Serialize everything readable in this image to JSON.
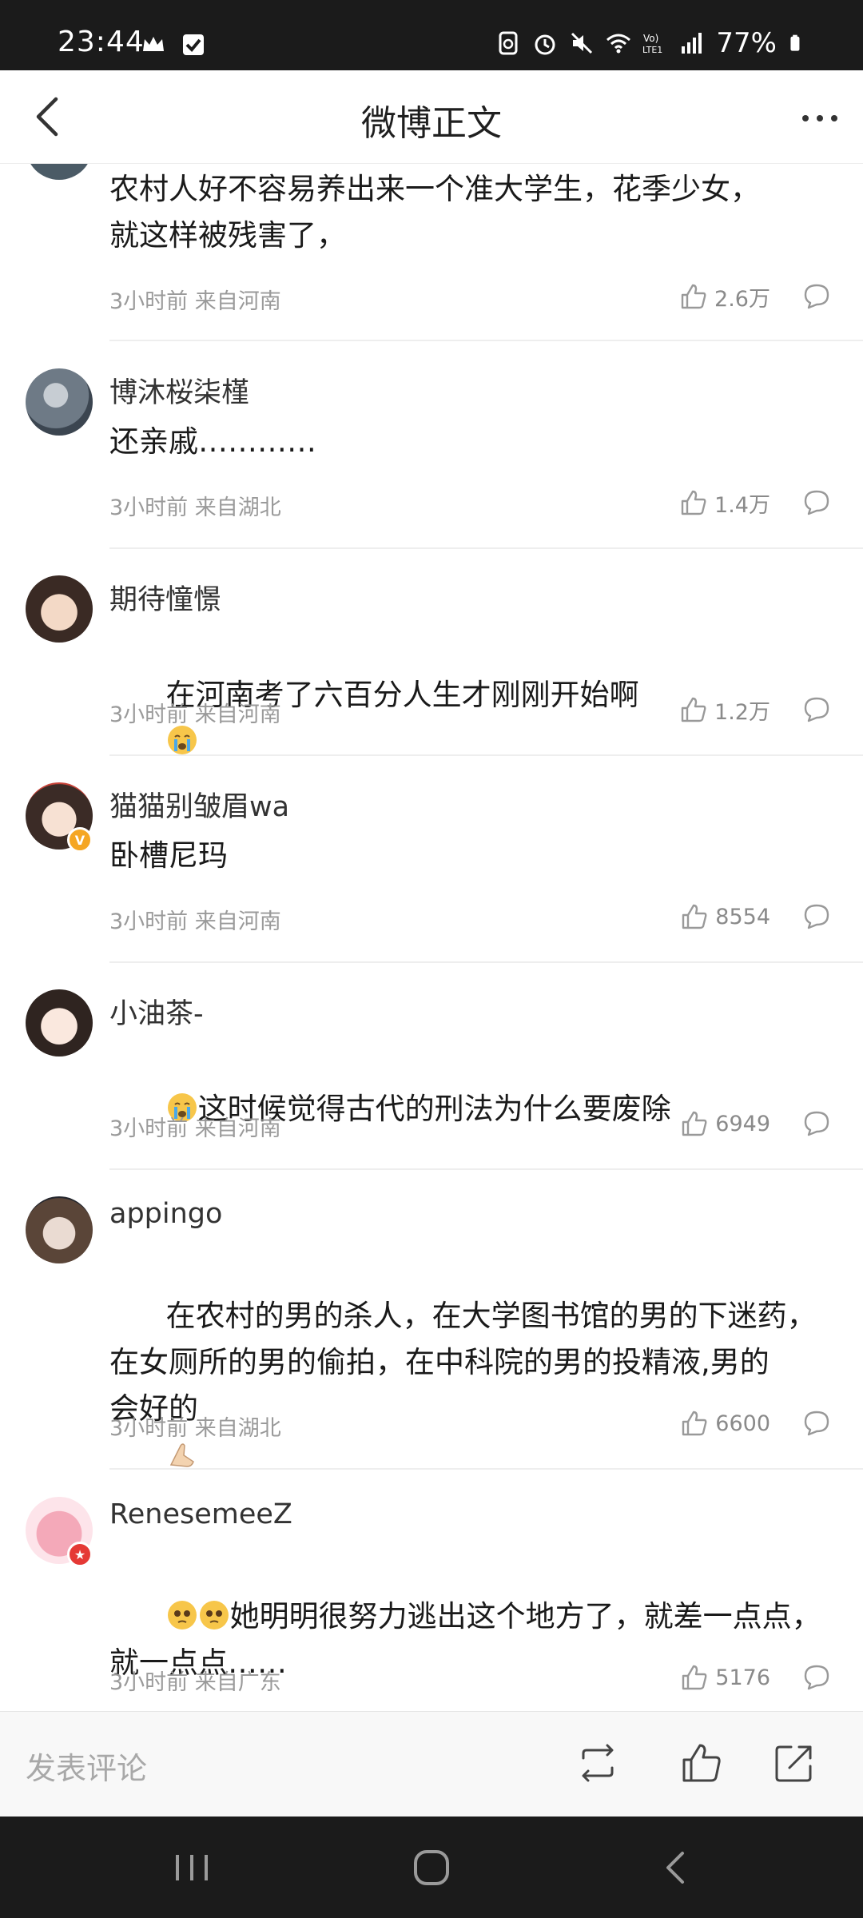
{
  "status_bar": {
    "time": "23:44",
    "battery": "77%",
    "left_icons": [
      "crown-icon",
      "checkbox-icon"
    ],
    "right_icons": [
      "recycle-icon",
      "alarm-icon",
      "mute-icon",
      "wifi-icon",
      "volte-icon",
      "signal-icon",
      "battery-icon"
    ],
    "volte_label": "Vo) LTE1"
  },
  "header": {
    "title": "微博正文",
    "back_icon": "chevron-left-icon",
    "more_icon": "more-dots-icon"
  },
  "comments": [
    {
      "user": "",
      "text": "农村人好不容易养出来一个准大学生，花季少女，\n就这样被残害了，",
      "meta": "3小时前 来自河南",
      "likes": "2.6万"
    },
    {
      "user": "博沐桜柒槿",
      "text": "还亲戚…………",
      "meta": "3小时前 来自湖北",
      "likes": "1.4万"
    },
    {
      "user": "期待憧憬",
      "text": "在河南考了六百分人生才刚刚开始啊",
      "meta": "3小时前 来自河南",
      "likes": "1.2万",
      "emoji_after": "crying-emoji"
    },
    {
      "user": "猫猫别皱眉wa",
      "text": "卧槽尼玛",
      "meta": "3小时前 来自河南",
      "likes": "8554",
      "badge": "V"
    },
    {
      "user": "小油茶-",
      "text": "这时候觉得古代的刑法为什么要废除",
      "meta": "3小时前 来自河南",
      "likes": "6949",
      "emoji_before": "crying-emoji"
    },
    {
      "user": "appingo",
      "text": "在农村的男的杀人，在大学图书馆的男的下迷药，\n在女厕所的男的偷拍，在中科院的男的投精液,男的\n会好的",
      "meta": "3小时前 来自湖北",
      "likes": "6600",
      "emoji_after": "praying-hands-emoji"
    },
    {
      "user": "RenesemeeZ",
      "text": "她明明很努力逃出这个地方了，就差一点点，\n就一点点……",
      "meta": "3小时前 来自广东",
      "likes": "5176",
      "emoji_before": "pleading-face-emoji x2"
    }
  ],
  "bottom_bar": {
    "comment_placeholder": "发表评论",
    "icons": [
      "repost-icon",
      "like-icon",
      "share-icon"
    ]
  },
  "nav_bar": {
    "icons": [
      "recent-apps-icon",
      "home-icon",
      "back-icon"
    ]
  },
  "colors": {
    "status_bg": "#1b1b1b",
    "text_primary": "#1a1a1a",
    "text_secondary": "#9a9a9a",
    "verified_badge": "#f5a623",
    "red_badge": "#e53935"
  }
}
